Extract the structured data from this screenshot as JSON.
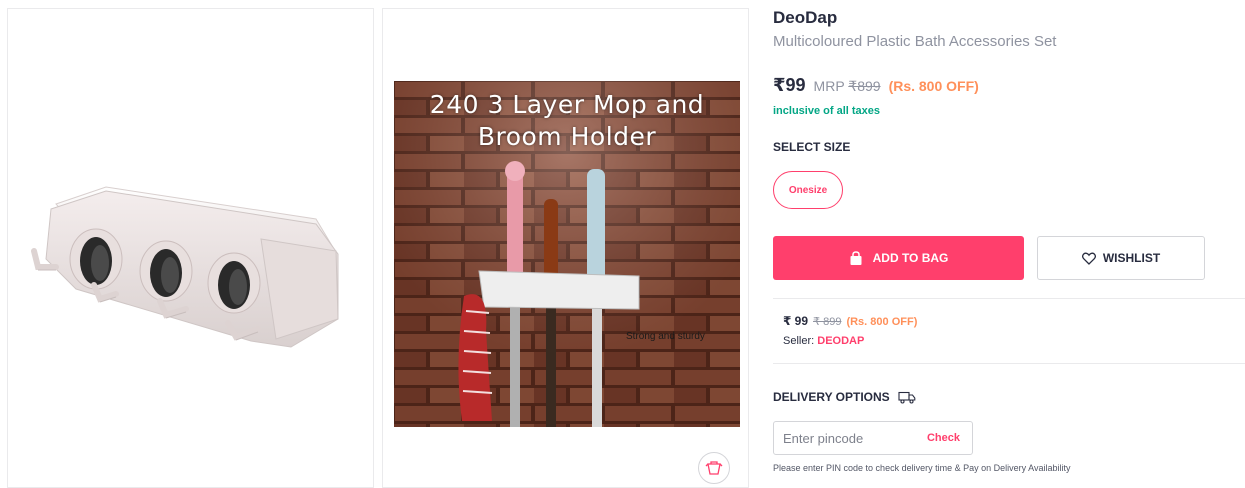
{
  "product": {
    "brand": "DeoDap",
    "name": "Multicoloured Plastic Bath Accessories Set",
    "price": "₹99",
    "mrp_label": "MRP",
    "mrp_value": "₹899",
    "discount": "(Rs. 800 OFF)",
    "tax_note": "inclusive of all taxes"
  },
  "images": {
    "photo_title_line1": "240 3 Layer Mop and",
    "photo_title_line2": "Broom Holder",
    "photo_caption": "Strong and sturdy"
  },
  "size": {
    "heading": "SELECT SIZE",
    "options": [
      "Onesize"
    ]
  },
  "actions": {
    "add_to_bag": "ADD TO BAG",
    "wishlist": "WISHLIST"
  },
  "seller": {
    "price": "₹ 99",
    "mrp": "₹ 899",
    "discount": "(Rs. 800 OFF)",
    "label": "Seller:",
    "name": "DEODAP"
  },
  "delivery": {
    "heading": "DELIVERY OPTIONS",
    "pin_placeholder": "Enter pincode",
    "check_label": "Check",
    "note": "Please enter PIN code to check delivery time & Pay on Delivery Availability"
  },
  "colors": {
    "accent": "#ff3f6c",
    "discount": "#ff905a",
    "tax_green": "#03a685",
    "text_dark": "#282c3f",
    "text_muted": "#8f93a0"
  },
  "icons": [
    "bag-icon",
    "heart-icon",
    "truck-icon",
    "similar-products-icon"
  ]
}
